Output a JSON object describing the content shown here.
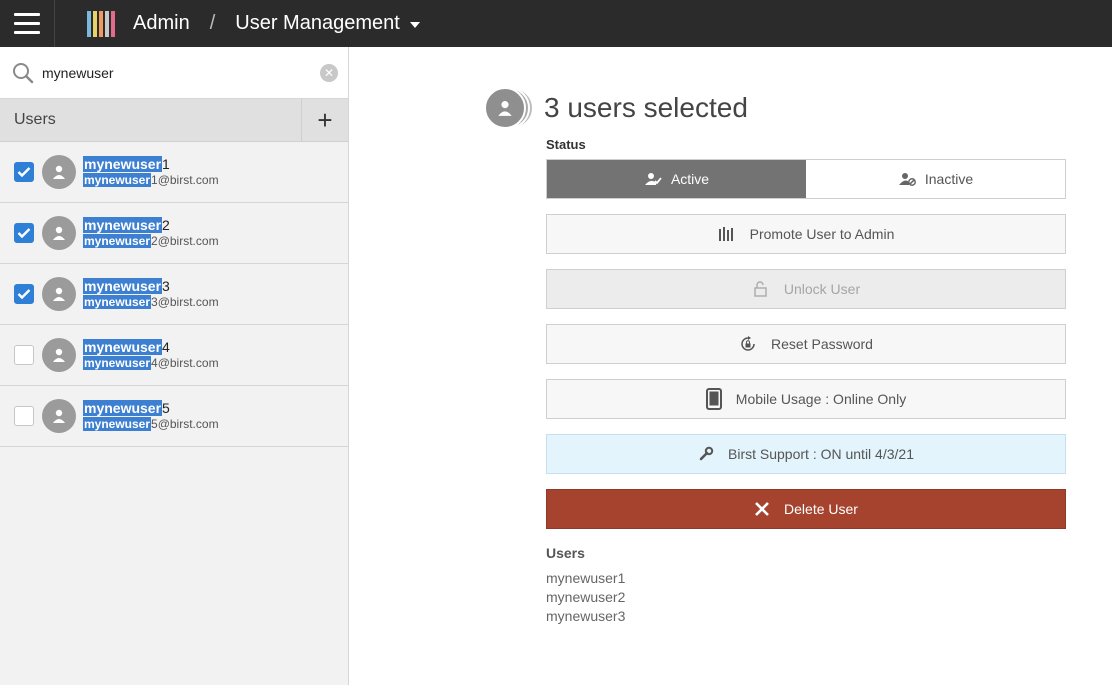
{
  "topbar": {
    "app_name": "Admin",
    "separator": "/",
    "page_name": "User Management"
  },
  "search": {
    "value": "mynewuser",
    "placeholder": ""
  },
  "sidebar": {
    "title": "Users",
    "add_label": "+"
  },
  "users": [
    {
      "hl": "mynewuser",
      "num": "1",
      "email_hl": "mynewuser",
      "email_rest": "1@birst.com",
      "checked": true
    },
    {
      "hl": "mynewuser",
      "num": "2",
      "email_hl": "mynewuser",
      "email_rest": "2@birst.com",
      "checked": true
    },
    {
      "hl": "mynewuser",
      "num": "3",
      "email_hl": "mynewuser",
      "email_rest": "3@birst.com",
      "checked": true
    },
    {
      "hl": "mynewuser",
      "num": "4",
      "email_hl": "mynewuser",
      "email_rest": "4@birst.com",
      "checked": false
    },
    {
      "hl": "mynewuser",
      "num": "5",
      "email_hl": "mynewuser",
      "email_rest": "5@birst.com",
      "checked": false
    }
  ],
  "selection": {
    "title": "3 users selected"
  },
  "status": {
    "label": "Status",
    "active": "Active",
    "inactive": "Inactive",
    "selected": "Active"
  },
  "actions": {
    "promote": "Promote User to Admin",
    "unlock": "Unlock User",
    "reset": "Reset Password",
    "mobile": "Mobile Usage : Online Only",
    "support": "Birst Support : ON until 4/3/21",
    "delete": "Delete User"
  },
  "selected_users": {
    "title": "Users",
    "names": [
      "mynewuser1",
      "mynewuser2",
      "mynewuser3"
    ]
  },
  "colors": {
    "topbar": "#2b2b2b",
    "checkbox_checked": "#2e7fd6",
    "highlight": "#3d7fd0",
    "active_toggle": "#737373",
    "support_bg": "#e3f4fd",
    "delete_bg": "#a5432e"
  }
}
